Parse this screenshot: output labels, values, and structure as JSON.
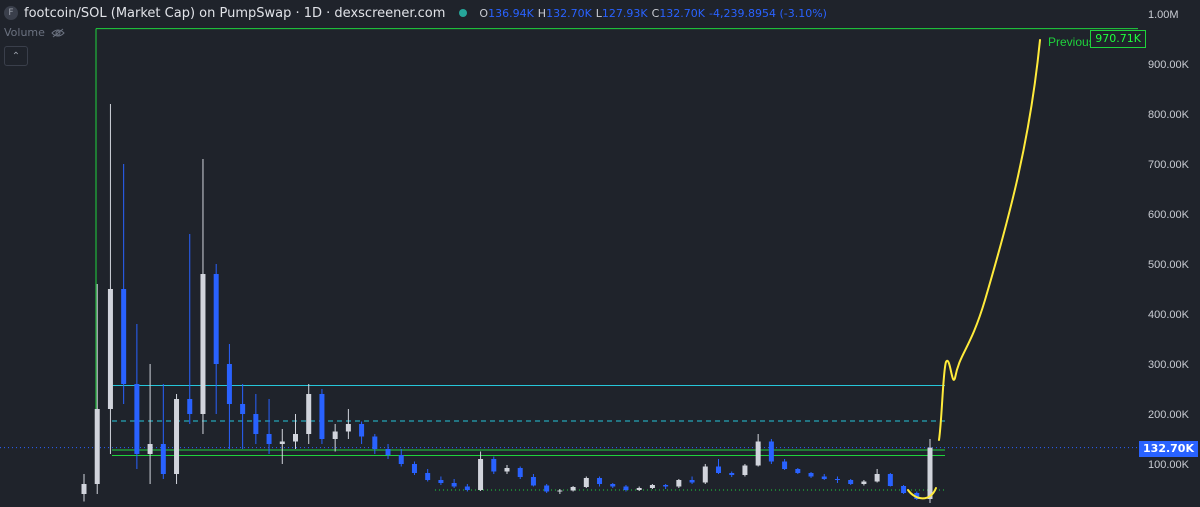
{
  "header": {
    "coin_icon": "F",
    "title": "footcoin/SOL (Market Cap) on PumpSwap · 1D · dexscreener.com",
    "open_key": "O",
    "open": "136.94K",
    "high_key": "H",
    "high": "132.70K",
    "low_key": "L",
    "low": "127.93K",
    "close_key": "C",
    "close": "132.70K",
    "change": "-4,239.8954 (-3.10%)"
  },
  "volume_label": "Volume",
  "collapse_icon": "chevron-up-icon",
  "colors": {
    "background": "#1f232b",
    "candle_up": "#d1d4dc",
    "candle_down": "#2962ff",
    "resistance": "#26c6da",
    "support": "#1fd33c",
    "annotation": "#ffeb3b",
    "price_badge": "#2962ff"
  },
  "annotations": {
    "previous_ath_text": "Previous ATH",
    "ath_value_label": "970.71K",
    "current_price_label": "132.70K"
  },
  "chart_data": {
    "type": "candlestick",
    "title": "footcoin/SOL (Market Cap) on PumpSwap · 1D · dexscreener.com",
    "y_axis": {
      "scale": "linear",
      "ticks": [
        "1.00M",
        "900.00K",
        "800.00K",
        "700.00K",
        "600.00K",
        "500.00K",
        "400.00K",
        "300.00K",
        "200.00K",
        "100.00K"
      ],
      "range": [
        0,
        1000000
      ]
    },
    "levels": [
      {
        "name": "Previous ATH",
        "value": 970710,
        "style": "solid",
        "color": "#1fd33c"
      },
      {
        "value": 257000,
        "style": "solid",
        "color": "#26c6da"
      },
      {
        "value": 186000,
        "style": "dashed",
        "color": "#26c6da"
      },
      {
        "value": 128000,
        "style": "solid",
        "color": "#1fd33c"
      },
      {
        "value": 117000,
        "style": "solid",
        "color": "#1fd33c"
      },
      {
        "value": 48000,
        "style": "dotted",
        "color": "#1fd33c"
      },
      {
        "value": 132700,
        "style": "dotted",
        "color": "#2962ff"
      }
    ],
    "candles": [
      [
        40,
        80,
        25,
        60
      ],
      [
        60,
        460,
        40,
        210
      ],
      [
        210,
        820,
        120,
        450
      ],
      [
        450,
        700,
        220,
        260
      ],
      [
        260,
        380,
        90,
        120
      ],
      [
        120,
        300,
        60,
        140
      ],
      [
        140,
        260,
        70,
        80
      ],
      [
        80,
        240,
        60,
        230
      ],
      [
        230,
        560,
        180,
        200
      ],
      [
        200,
        710,
        160,
        480
      ],
      [
        480,
        500,
        200,
        300
      ],
      [
        300,
        340,
        130,
        220
      ],
      [
        220,
        260,
        130,
        200
      ],
      [
        200,
        240,
        140,
        160
      ],
      [
        160,
        230,
        120,
        140
      ],
      [
        140,
        170,
        100,
        145
      ],
      [
        145,
        200,
        130,
        160
      ],
      [
        160,
        260,
        140,
        240
      ],
      [
        240,
        250,
        140,
        150
      ],
      [
        150,
        180,
        125,
        165
      ],
      [
        165,
        210,
        150,
        180
      ],
      [
        180,
        185,
        140,
        155
      ],
      [
        155,
        160,
        120,
        130
      ],
      [
        130,
        140,
        110,
        118
      ],
      [
        118,
        130,
        95,
        100
      ],
      [
        100,
        105,
        78,
        82
      ],
      [
        82,
        90,
        65,
        68
      ],
      [
        68,
        75,
        58,
        62
      ],
      [
        62,
        70,
        52,
        55
      ],
      [
        55,
        60,
        45,
        48
      ],
      [
        48,
        125,
        46,
        110
      ],
      [
        110,
        115,
        80,
        85
      ],
      [
        85,
        98,
        80,
        92
      ],
      [
        92,
        95,
        70,
        74
      ],
      [
        74,
        80,
        55,
        57
      ],
      [
        57,
        60,
        42,
        45
      ],
      [
        45,
        50,
        40,
        47
      ],
      [
        47,
        56,
        45,
        54
      ],
      [
        54,
        75,
        52,
        72
      ],
      [
        72,
        75,
        55,
        60
      ],
      [
        60,
        62,
        52,
        55
      ],
      [
        55,
        58,
        45,
        48
      ],
      [
        48,
        55,
        46,
        52
      ],
      [
        52,
        60,
        50,
        58
      ],
      [
        58,
        60,
        50,
        55
      ],
      [
        55,
        70,
        52,
        68
      ],
      [
        68,
        75,
        60,
        63
      ],
      [
        63,
        100,
        60,
        95
      ],
      [
        95,
        110,
        80,
        82
      ],
      [
        82,
        85,
        74,
        78
      ],
      [
        78,
        100,
        75,
        97
      ],
      [
        97,
        160,
        95,
        145
      ],
      [
        145,
        150,
        100,
        105
      ],
      [
        105,
        110,
        88,
        90
      ],
      [
        90,
        92,
        80,
        82
      ],
      [
        82,
        84,
        72,
        75
      ],
      [
        75,
        80,
        68,
        70
      ],
      [
        70,
        75,
        62,
        68
      ],
      [
        68,
        70,
        58,
        60
      ],
      [
        60,
        68,
        57,
        65
      ],
      [
        65,
        90,
        63,
        80
      ],
      [
        80,
        82,
        55,
        56
      ],
      [
        56,
        58,
        40,
        42
      ],
      [
        42,
        45,
        28,
        30
      ],
      [
        30,
        150,
        22,
        132.7
      ]
    ]
  }
}
